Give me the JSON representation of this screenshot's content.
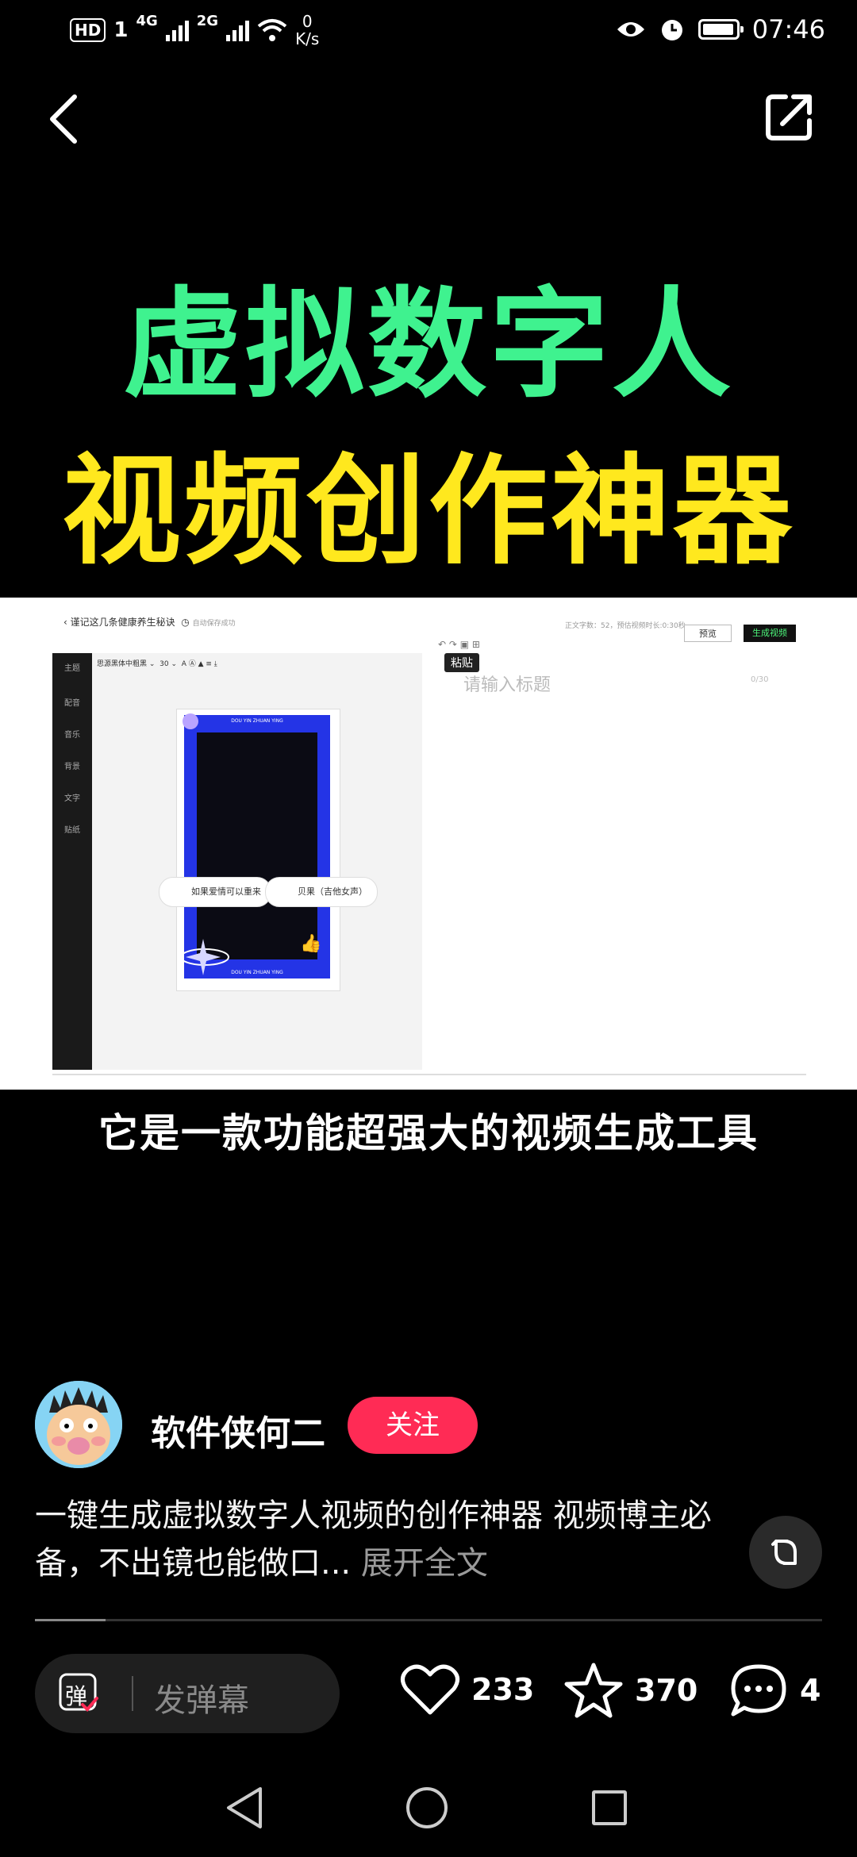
{
  "status_bar": {
    "hd": "HD",
    "sim1": "1",
    "net1": "4G",
    "net2": "2G",
    "speed_value": "0",
    "speed_unit": "K/s",
    "time": "07:46"
  },
  "video": {
    "headline_line1": "虚拟数字人",
    "headline_line2": "视频创作神器",
    "caption": "它是一款功能超强大的视频生成工具",
    "screenshot": {
      "doc_title": "谨记这几条健康养生秘诀",
      "autosave": "自动保存成功",
      "word_count": "正文字数：52，预估视频时长:0:30秒",
      "preview_btn": "预览",
      "generate_btn": "生成视频",
      "paste_tooltip": "粘贴",
      "title_placeholder": "请输入标题",
      "title_counter": "0/30",
      "font_select": "思源黑体中粗黑",
      "font_size": "30",
      "sidebar": [
        "主题",
        "配音",
        "音乐",
        "背景",
        "文字",
        "贴纸"
      ],
      "frame_top_text": "DOU YIN ZHUAN YING",
      "frame_bottom_text": "DOU YIN ZHUAN YING",
      "pill1": "如果爱情可以重来",
      "pill2": "贝果（吉他女声）"
    }
  },
  "author": {
    "name": "软件侠何二",
    "follow_label": "关注"
  },
  "description": {
    "text": "一键生成虚拟数字人视频的创作神器 视频博主必备，不出镜也能做口...",
    "more": "展开全文"
  },
  "progress": 0.09,
  "bottom_bar": {
    "danmu_icon_char": "弹",
    "danmu_placeholder": "发弹幕",
    "likes": "233",
    "favorites": "370",
    "comments": "4"
  },
  "colors": {
    "headline1": "#3ff28f",
    "headline2": "#ffe81e",
    "follow": "#ff2b55"
  },
  "icons": [
    "back-icon",
    "share-icon",
    "expand-icon",
    "heart-icon",
    "star-icon",
    "comment-icon",
    "nav-back-icon",
    "nav-home-icon",
    "nav-recent-icon"
  ]
}
